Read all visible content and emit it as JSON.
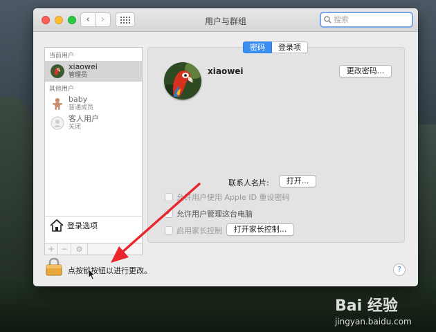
{
  "window": {
    "title": "用户与群组",
    "search_placeholder": "搜索"
  },
  "sidebar": {
    "current_header": "当前用户",
    "other_header": "其他用户",
    "current_user": {
      "name": "xiaowei",
      "role": "管理员"
    },
    "other_users": [
      {
        "name": "baby",
        "role": "普通成员"
      },
      {
        "name": "客人用户",
        "role": "关闭"
      }
    ],
    "login_options_label": "登录选项",
    "toolbar": {
      "add": "+",
      "remove": "−"
    }
  },
  "panel": {
    "tabs": [
      {
        "label": "密码"
      },
      {
        "label": "登录项"
      }
    ],
    "username": "xiaowei",
    "change_password_label": "更改密码...",
    "contact_card_label": "联系人名片:",
    "open_label": "打开...",
    "checkboxes": [
      {
        "label": "允许用户使用 Apple ID 重设密码",
        "checked": false
      },
      {
        "label": "允许用户管理这台电脑",
        "checked": true
      },
      {
        "label": "启用家长控制",
        "checked": false
      }
    ],
    "parental_button_label": "打开家长控制..."
  },
  "footer": {
    "lock_text": "点按锁按钮以进行更改。",
    "help_label": "?"
  },
  "watermark": {
    "logo_text": "Bai 经验",
    "site": "jingyan.baidu.com"
  },
  "colors": {
    "accent": "#3b8ff0",
    "annotation": "#e8262b"
  }
}
